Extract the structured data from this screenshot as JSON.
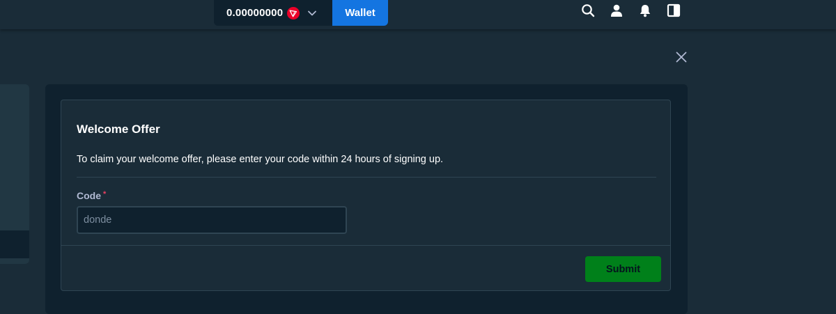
{
  "header": {
    "balance": "0.00000000",
    "currency_icon": "tron-icon",
    "currency_color": "#eb0029",
    "wallet_label": "Wallet",
    "accent": "#1475e1",
    "icons": [
      "search-icon",
      "user-icon",
      "bell-icon",
      "sidebar-toggle-icon"
    ]
  },
  "modal": {
    "close_icon": "close-icon",
    "title": "Welcome Offer",
    "description": "To claim your welcome offer, please enter your code within 24 hours of signing up.",
    "code_label": "Code",
    "required_mark": "*",
    "code_value": "",
    "code_placeholder": "donde",
    "submit_label": "Submit",
    "submit_color": "#00801a"
  }
}
